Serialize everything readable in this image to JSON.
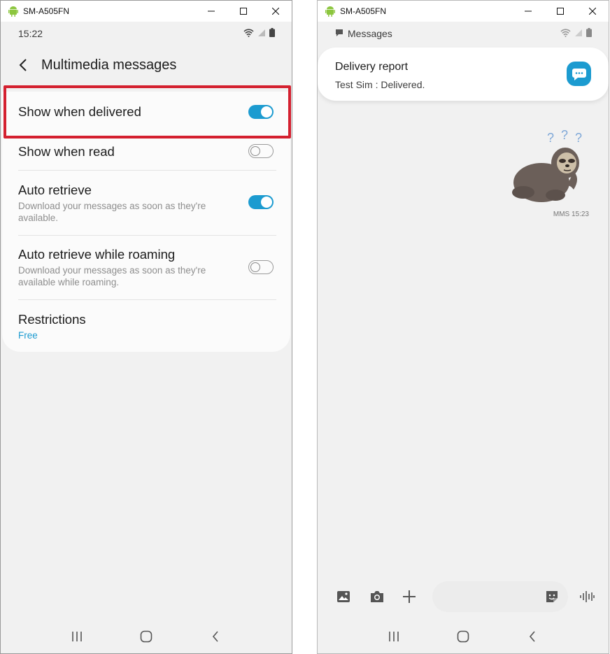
{
  "left_window": {
    "title": "SM-A505FN",
    "status_time": "15:22",
    "page_title": "Multimedia messages",
    "settings": [
      {
        "title": "Show when delivered",
        "subtitle": "",
        "toggle": "on"
      },
      {
        "title": "Show when read",
        "subtitle": "",
        "toggle": "off"
      },
      {
        "title": "Auto retrieve",
        "subtitle": "Download your messages as soon as they're available.",
        "toggle": "on"
      },
      {
        "title": "Auto retrieve while roaming",
        "subtitle": "Download your messages as soon as they're available while roaming.",
        "toggle": "off"
      },
      {
        "title": "Restrictions",
        "value": "Free"
      }
    ],
    "highlight_color": "#d4202f"
  },
  "right_window": {
    "title": "SM-A505FN",
    "status_app": "Messages",
    "notification": {
      "title": "Delivery report",
      "text": "Test Sim : Delivered."
    },
    "message_meta": "MMS 15:23",
    "sticker_icon": "confused-sloth-sticker",
    "composer_placeholder": ""
  },
  "colors": {
    "accent": "#1c9bd0",
    "background": "#f1f1f1",
    "card": "#fbfbfb"
  },
  "icons": [
    "android-icon",
    "minimize-icon",
    "maximize-icon",
    "close-icon",
    "wifi-icon",
    "signal-icon",
    "battery-icon",
    "back-arrow-icon",
    "messages-app-icon",
    "gallery-icon",
    "camera-icon",
    "plus-icon",
    "sticker-icon",
    "voice-icon",
    "recents-icon",
    "home-icon",
    "nav-back-icon"
  ]
}
